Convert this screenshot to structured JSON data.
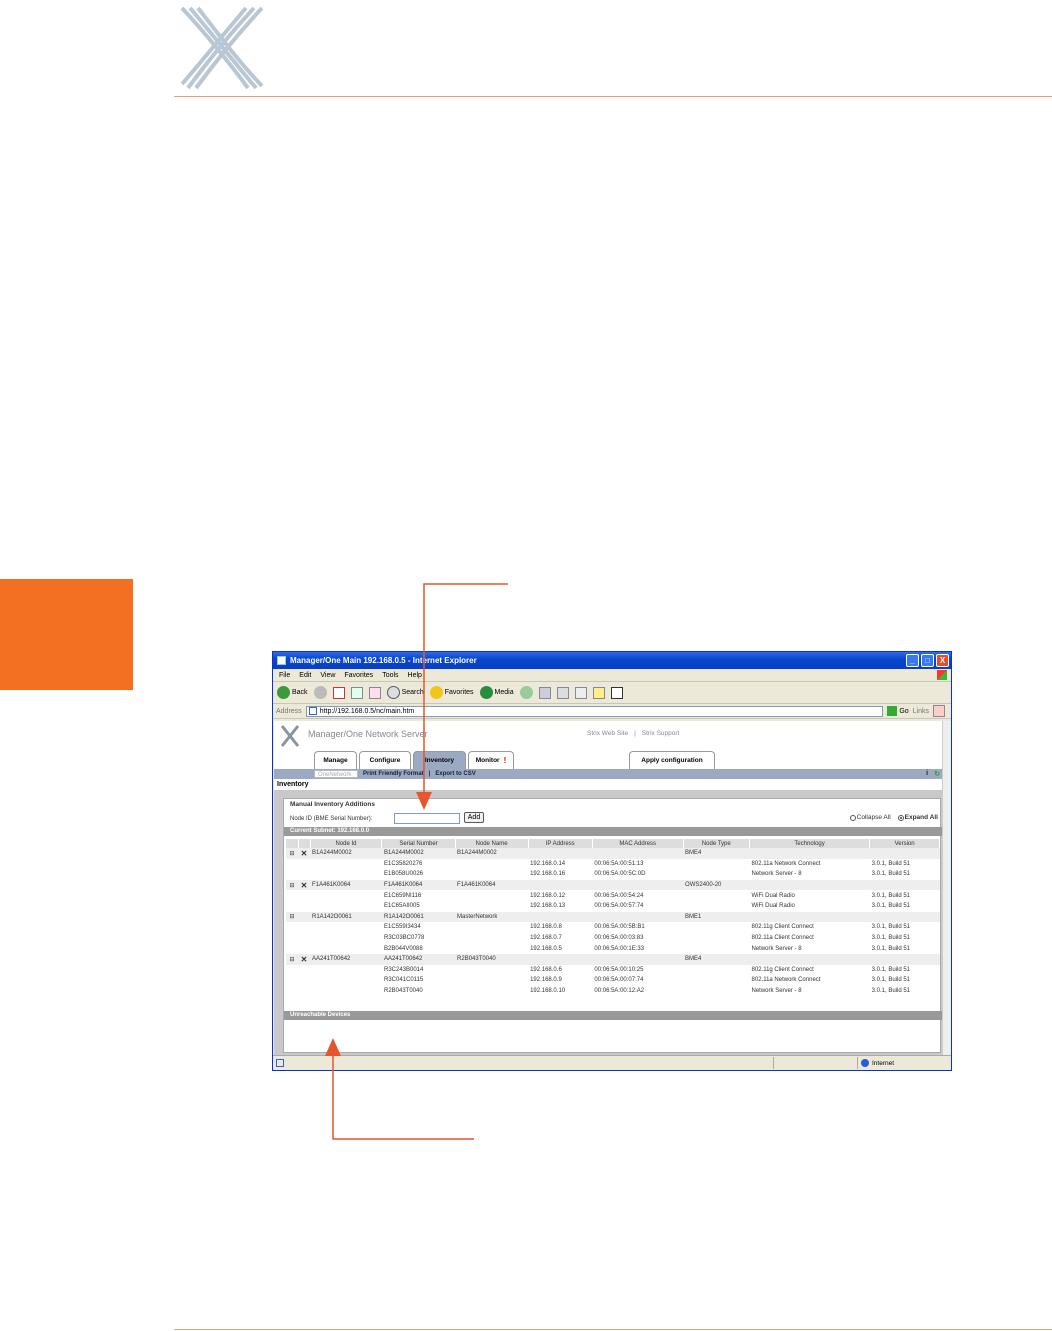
{
  "window": {
    "title": "Manager/One Main 192.168.0.5 - Internet Explorer",
    "minimize_glyph": "_",
    "maximize_glyph": "□",
    "close_glyph": "X"
  },
  "menubar": [
    "File",
    "Edit",
    "View",
    "Favorites",
    "Tools",
    "Help"
  ],
  "toolbar": {
    "back_label": "Back",
    "search_label": "Search",
    "favorites_label": "Favorites",
    "media_label": "Media"
  },
  "addressbar": {
    "label": "Address",
    "url": "http://192.168.0.5/nc/main.htm",
    "go_label": "Go",
    "links_label": "Links"
  },
  "app": {
    "title": "Manager/One Network Server",
    "links": [
      "Strix Web Site",
      "|",
      "Strix Support"
    ],
    "tabs": [
      {
        "label": "Manage"
      },
      {
        "label": "Configure"
      },
      {
        "label": "Inventory"
      },
      {
        "label": "Monitor",
        "alert": "!"
      },
      {
        "label": "Apply configuration"
      }
    ],
    "subnav": {
      "select_value": "OneNetwork",
      "print_label": "Print Friendly Format",
      "separator": "|",
      "export_label": "Export to CSV",
      "info_glyph": "i",
      "refresh_glyph": "↻"
    },
    "section_title": "Inventory",
    "manual": {
      "title": "Manual Inventory Additions",
      "node_label": "Node ID (BME Serial Number):",
      "node_value": "",
      "add_label": "Add",
      "collapse_label": "Collapse All",
      "expand_label": "Expand All"
    },
    "subnet_label": "Current Subnet: 192.168.0.0",
    "unreachable_label": "Unreachable Devices",
    "columns": [
      "Node Id",
      "Serial Number",
      "Node Name",
      "IP Address",
      "MAC Address",
      "Node Type",
      "Technology",
      "Version"
    ],
    "groups": [
      {
        "expand": "⊟",
        "del": "✕",
        "node_id": "B1A244M0002",
        "serial": "B1A244M0002",
        "name": "B1A244M0002",
        "type": "BME4",
        "children": [
          {
            "serial": "E1C35820276",
            "ip": "192.168.0.14",
            "mac": "00:06:5A:00:51:13",
            "tech": "802.11a Network Connect",
            "ver": "3.0.1, Build 51"
          },
          {
            "serial": "E1B058U0026",
            "ip": "192.168.0.16",
            "mac": "00:06:5A:00:5C:0D",
            "tech": "Network Server - 8",
            "ver": "3.0.1, Build 51"
          }
        ]
      },
      {
        "expand": "⊟",
        "del": "✕",
        "node_id": "F1A461K0064",
        "serial": "F1A461K0064",
        "name": "F1A461K0064",
        "type": "OWS2400-20",
        "children": [
          {
            "serial": "E1C659NI116",
            "ip": "192.168.0.12",
            "mac": "00:06:5A:00:54:24",
            "tech": "WiFi Dual Radio",
            "ver": "3.0.1, Build 51"
          },
          {
            "serial": "E1C65AII005",
            "ip": "192.168.0.13",
            "mac": "00:06:5A:00:57:74",
            "tech": "WiFi Dual Radio",
            "ver": "3.0.1, Build 51"
          }
        ]
      },
      {
        "expand": "⊟",
        "del": "",
        "node_id": "R1A142O0061",
        "serial": "R1A142O0061",
        "name": "MasterNetwork",
        "type": "BME1",
        "children": [
          {
            "serial": "E1C559I3434",
            "ip": "192.168.0.8",
            "mac": "00:06:5A:00:5B:B1",
            "tech": "802.11g Client Connect",
            "ver": "3.0.1, Build 51"
          },
          {
            "serial": "R3C03BC0778",
            "ip": "192.168.0.7",
            "mac": "00:06:5A:00:03:83",
            "tech": "802.11a Client Connect",
            "ver": "3.0.1, Build 51"
          },
          {
            "serial": "B2B044V0088",
            "ip": "192.168.0.5",
            "mac": "00:06:5A:00:1E:33",
            "tech": "Network Server - 8",
            "ver": "3.0.1, Build 51"
          }
        ]
      },
      {
        "expand": "⊟",
        "del": "✕",
        "node_id": "AA241T00642",
        "serial": "AA241T00642",
        "name": "R2B043T0040",
        "type": "BME4",
        "children": [
          {
            "serial": "R3C243B0014",
            "ip": "192.168.0.6",
            "mac": "00:06:5A:00:10:25",
            "tech": "802.11g Client Connect",
            "ver": "3.0.1, Build 51"
          },
          {
            "serial": "R3C041C0115",
            "ip": "192.168.0.9",
            "mac": "00:06:5A:00:07:74",
            "tech": "802.11a Network Connect",
            "ver": "3.0.1, Build 51"
          },
          {
            "serial": "R2B043T0040",
            "ip": "192.168.0.10",
            "mac": "00:06:5A:00:12:A2",
            "tech": "Network Server - 8",
            "ver": "3.0.1, Build 51"
          }
        ]
      }
    ]
  },
  "statusbar": {
    "zone": "Internet"
  },
  "colors": {
    "accent_orange": "#f36f21",
    "rule": "#e8a17a",
    "callout": "#e4572e",
    "xp_title": "#0a46d0",
    "tab_active": "#9ba9c2"
  }
}
